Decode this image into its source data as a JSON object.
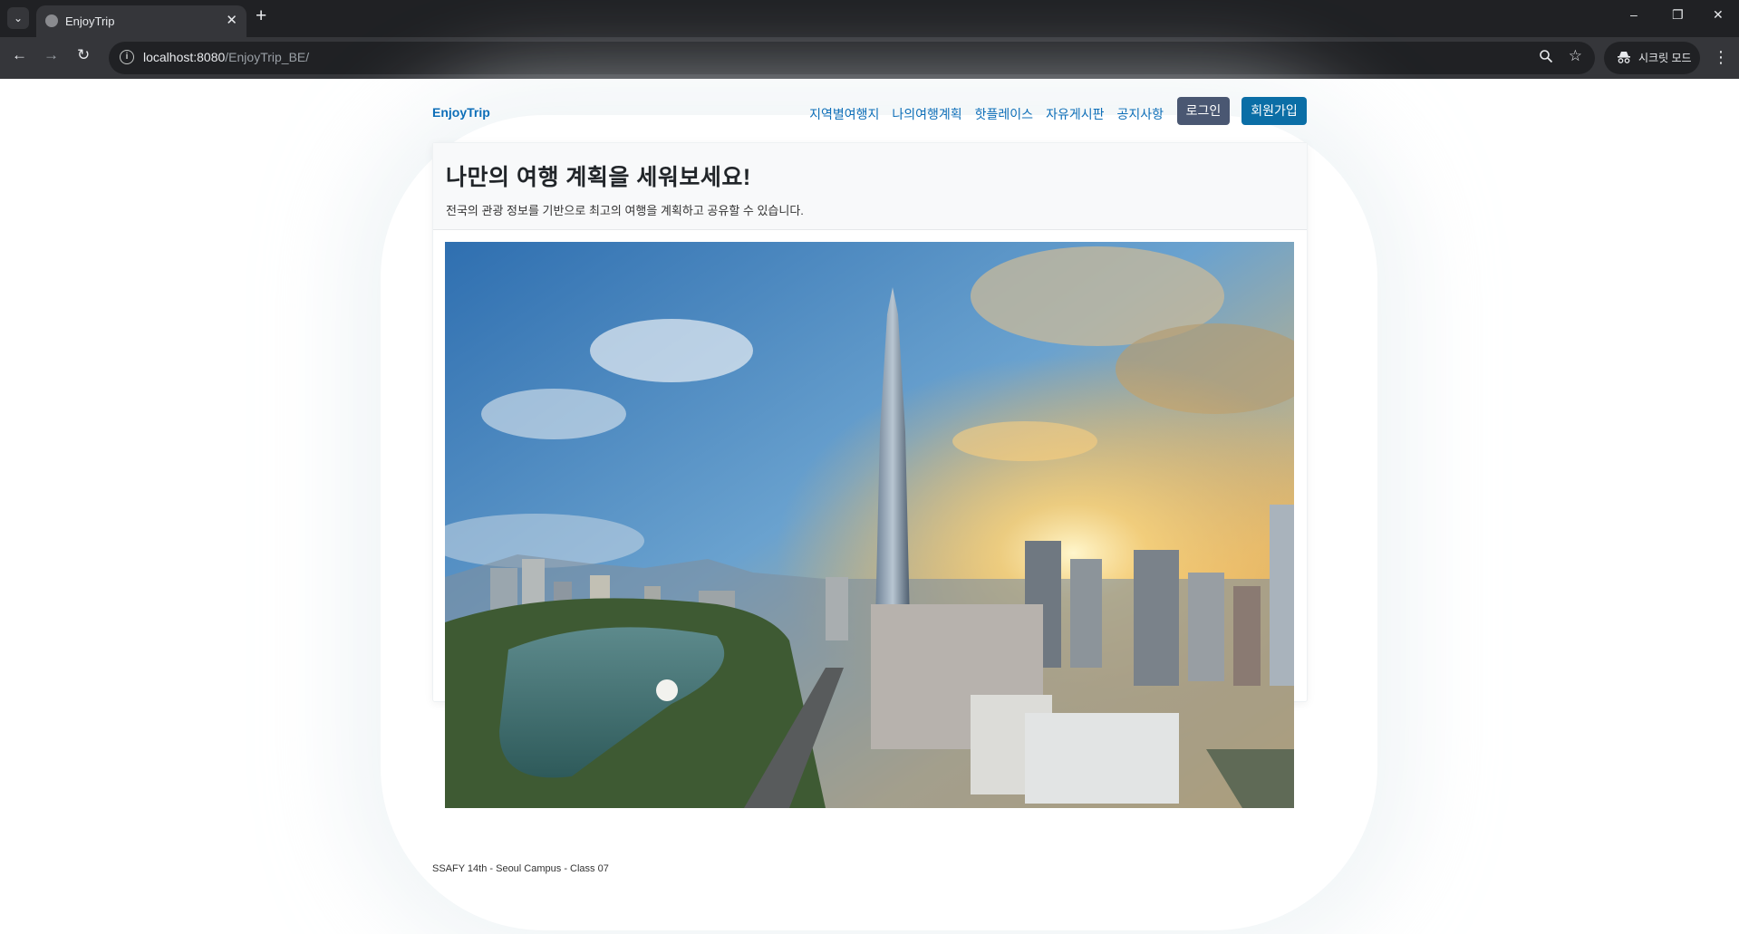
{
  "browser": {
    "tab_title": "EnjoyTrip",
    "tab_close": "✕",
    "new_tab": "+",
    "url_host": "localhost:8080",
    "url_path": "/EnjoyTrip_BE/",
    "incognito_label": "시크릿 모드",
    "window_controls": [
      "–",
      "❐",
      "✕"
    ]
  },
  "nav": {
    "brand": "EnjoyTrip",
    "links": [
      "지역별여행지",
      "나의여행계획",
      "핫플레이스",
      "자유게시판",
      "공지사항"
    ],
    "login": "로그인",
    "signup": "회원가입"
  },
  "hero": {
    "title": "나만의 여행 계획을 세워보세요!",
    "subtitle": "전국의 관광 정보를 기반으로 최고의 여행을 계획하고 공유할 수 있습니다."
  },
  "footer": {
    "text": "SSAFY 14th - Seoul Campus - Class 07"
  },
  "colors": {
    "brand": "#0d6eb8",
    "login_bg": "#4a5772",
    "signup_bg": "#0b6ea6",
    "chrome_dark": "#202124"
  }
}
